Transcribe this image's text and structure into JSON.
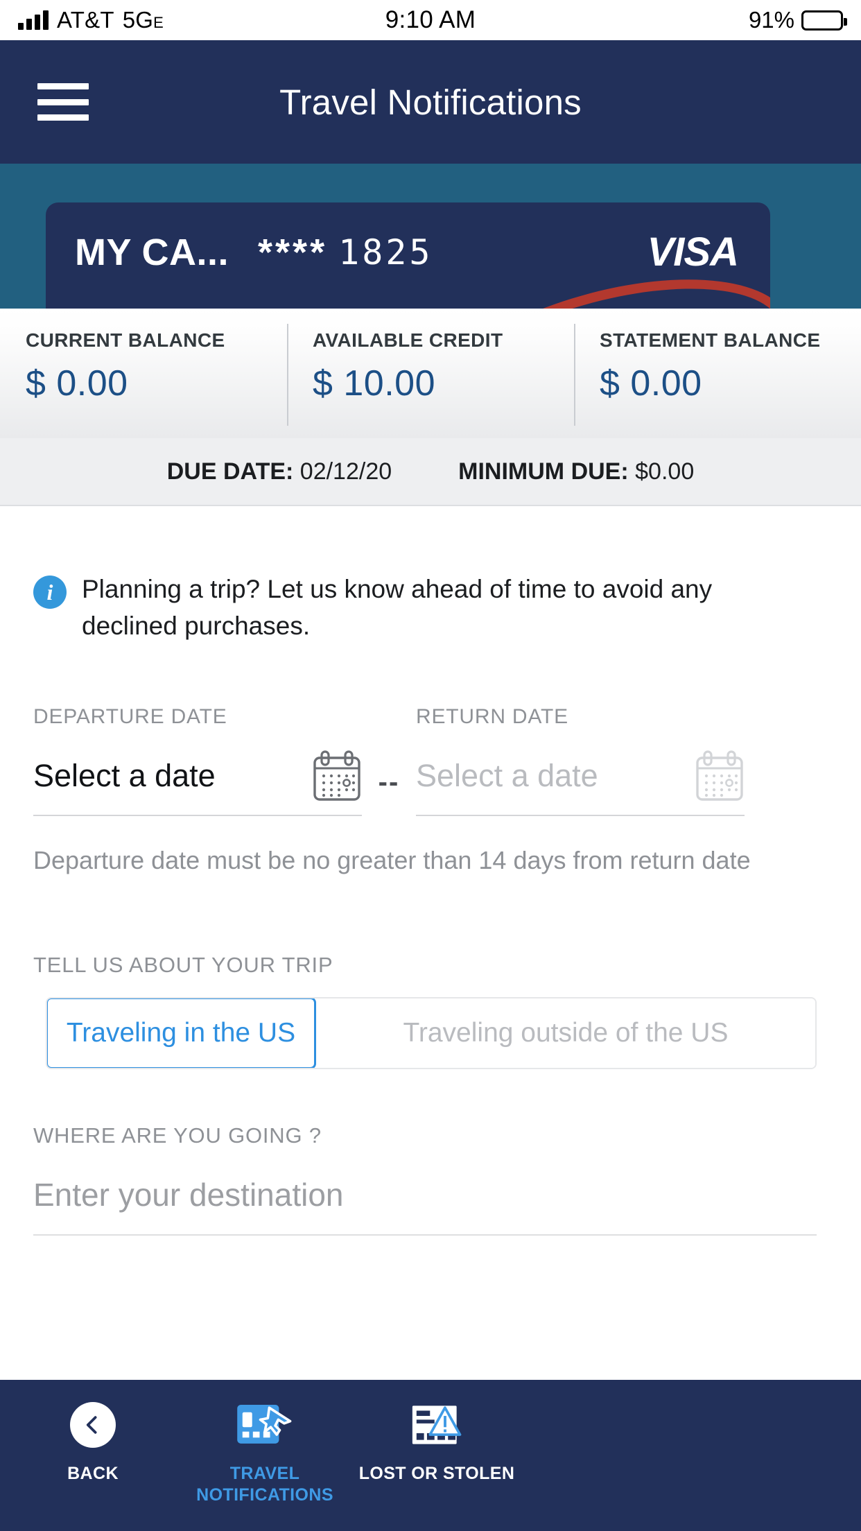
{
  "status_bar": {
    "carrier": "AT&T",
    "network": "5G",
    "network_sub": "E",
    "time": "9:10 AM",
    "battery_percent": "91%",
    "signal_icon": "signal-bars-icon",
    "battery_icon": "battery-icon"
  },
  "header": {
    "title": "Travel Notifications",
    "menu_icon": "hamburger-menu-icon"
  },
  "card": {
    "nickname": "MY CA...",
    "mask": "****",
    "last_four": "1825",
    "brand": "VISA",
    "card_bg": "#22305a",
    "banner_bg": "#226080"
  },
  "balances": [
    {
      "label": "CURRENT BALANCE",
      "value": "$ 0.00"
    },
    {
      "label": "AVAILABLE CREDIT",
      "value": "$ 10.00"
    },
    {
      "label": "STATEMENT BALANCE",
      "value": "$ 0.00"
    }
  ],
  "due": {
    "due_date_label": "DUE DATE:",
    "due_date_value": "02/12/20",
    "minimum_label": "MINIMUM DUE:",
    "minimum_value": "$0.00"
  },
  "info_note": {
    "icon": "info-circle-icon",
    "text": "Planning a trip? Let us know ahead of time to avoid any declined purchases."
  },
  "dates": {
    "departure_label": "DEPARTURE DATE",
    "departure_placeholder": "Select a date",
    "return_label": "RETURN DATE",
    "return_placeholder": "Select a date",
    "separator": "--",
    "helper_text": "Departure date must be no greater than 14 days from return date",
    "calendar_icon": "calendar-icon"
  },
  "trip": {
    "section_label": "TELL US ABOUT YOUR TRIP",
    "options": [
      {
        "label": "Traveling in the US",
        "selected": true
      },
      {
        "label": "Traveling outside of the US",
        "selected": false
      }
    ],
    "accent": "#2d8fe0"
  },
  "destination": {
    "label": "WHERE ARE YOU GOING ?",
    "placeholder": "Enter your destination",
    "value": ""
  },
  "bottom_nav": [
    {
      "label": "BACK",
      "icon": "chevron-left-circle-icon",
      "active": false
    },
    {
      "label": "TRAVEL NOTIFICATIONS",
      "icon": "card-airplane-icon",
      "active": true
    },
    {
      "label": "LOST OR STOLEN",
      "icon": "card-warning-icon",
      "active": false
    }
  ]
}
